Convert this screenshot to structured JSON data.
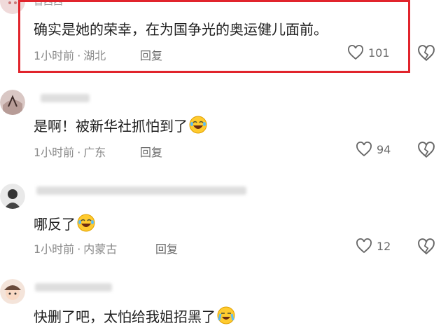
{
  "comments": [
    {
      "username": "晋西西",
      "text": "确实是她的荣幸，在为国争光的奥运健儿面前。",
      "time": "1小时前",
      "location": "湖北",
      "reply_label": "回复",
      "likes": "101",
      "highlighted": true
    },
    {
      "username": "",
      "text": "是啊！被新华社抓怕到了",
      "emoji": "laughing-tears-emoji",
      "time": "1小时前",
      "location": "广东",
      "reply_label": "回复",
      "likes": "94"
    },
    {
      "username": "",
      "text": "哪反了",
      "emoji": "laughing-tears-emoji",
      "time": "1小时前",
      "location": "内蒙古",
      "reply_label": "回复",
      "likes": "12"
    },
    {
      "username": "",
      "text": "快删了吧，太怕给我姐招黑了",
      "emoji": "crying-laughing-emoji",
      "time": "",
      "location": "",
      "reply_label": ""
    }
  ],
  "separator": "·",
  "colors": {
    "highlight_border": "#e1242c",
    "meta_text": "#8a8a8a",
    "body_text": "#1d1d1d"
  },
  "icons": [
    "heart-outline-icon",
    "broken-heart-icon",
    "laughing-tears-emoji"
  ]
}
